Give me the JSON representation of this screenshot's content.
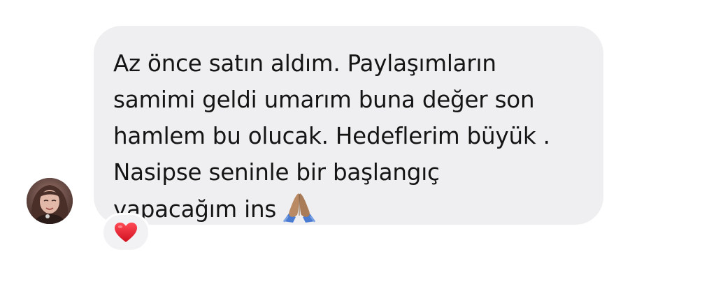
{
  "message": {
    "text": "Az önce satın aldım. Paylaşımların\nsamimi geldi umarım buna değer son\nhamlem bu olucak. Hedeflerim büyük .\nNasipse seninle bir başlangıç\nyapacağım ins",
    "emoji": "folded-hands",
    "bubble_color": "#efeff1"
  },
  "sender": {
    "avatar": "profile-photo"
  },
  "reaction": {
    "emoji": "red-heart",
    "color": "#e8212f"
  }
}
